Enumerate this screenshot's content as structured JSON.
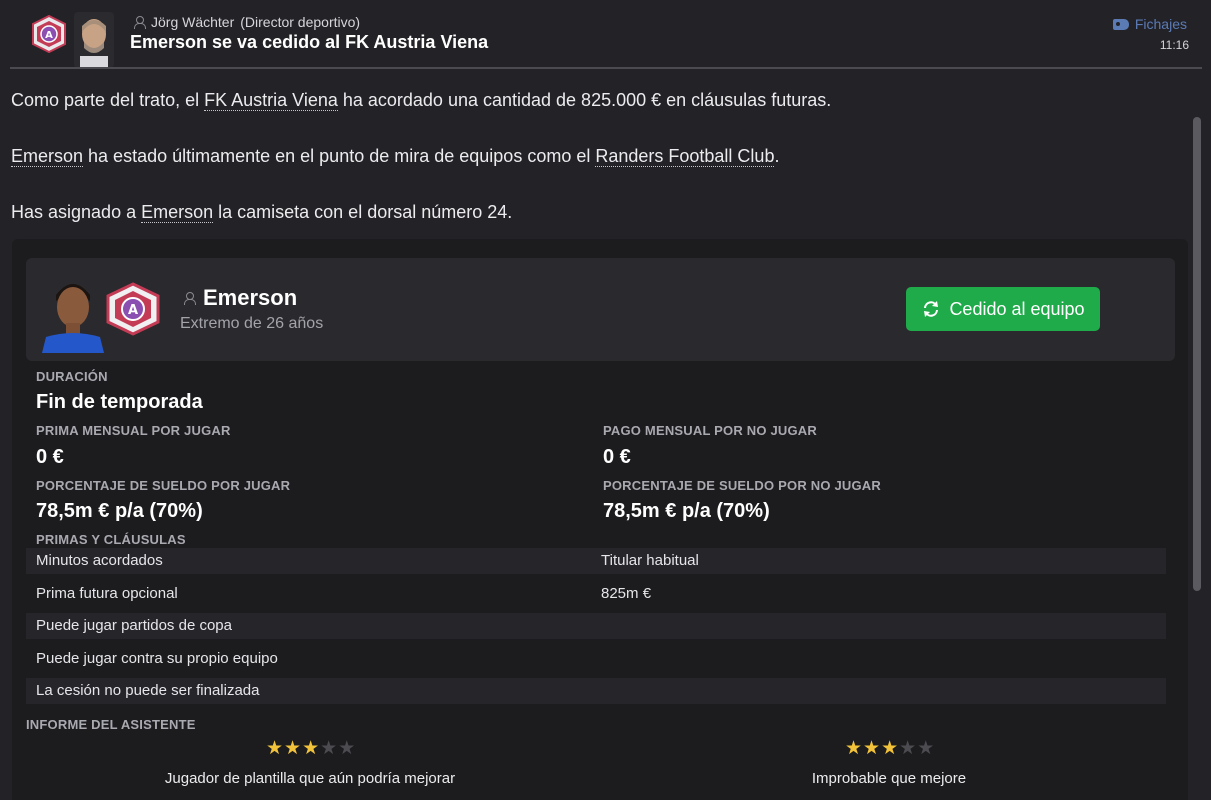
{
  "header": {
    "sender_name": "Jörg Wächter",
    "sender_role": "(Director deportivo)",
    "headline": "Emerson se va cedido al FK Austria Viena",
    "category": "Fichajes",
    "time": "11:16",
    "accent_color": "#5b7bb5"
  },
  "body": {
    "para1": {
      "pre": "Como parte del trato, el ",
      "link": "FK Austria Viena",
      "post": " ha acordado una cantidad de 825.000 € en cláusulas futuras."
    },
    "para2": {
      "link1": "Emerson",
      "mid": " ha estado últimamente en el punto de mira de equipos como el ",
      "link2": "Randers Football Club",
      "post": "."
    },
    "para3": {
      "pre": "Has asignado a ",
      "link": "Emerson",
      "post": " la camiseta con el dorsal número 24."
    }
  },
  "player": {
    "name": "Emerson",
    "description": "Extremo de 26 años",
    "status_button": "Cedido al equipo",
    "status_color": "#1fab4a"
  },
  "loan": {
    "duration_label": "DURACIÓN",
    "duration_value": "Fin de temporada",
    "monthly_fee_play_label": "PRIMA MENSUAL POR JUGAR",
    "monthly_fee_play_value": "0 €",
    "monthly_fee_noplay_label": "PAGO MENSUAL POR NO JUGAR",
    "monthly_fee_noplay_value": "0 €",
    "wage_play_label": "PORCENTAJE DE SUELDO POR JUGAR",
    "wage_play_value": "78,5m € p/a (70%)",
    "wage_noplay_label": "PORCENTAJE DE SUELDO POR NO JUGAR",
    "wage_noplay_value": "78,5m € p/a (70%)",
    "clauses_label": "PRIMAS Y CLÁUSULAS",
    "clauses": [
      {
        "name": "Minutos acordados",
        "value": "Titular habitual"
      },
      {
        "name": "Prima futura opcional",
        "value": "825m €"
      },
      {
        "name": "Puede jugar partidos de copa",
        "value": ""
      },
      {
        "name": "Puede jugar contra su propio equipo",
        "value": ""
      },
      {
        "name": "La cesión no puede ser finalizada",
        "value": ""
      }
    ]
  },
  "report": {
    "label": "INFORME DEL ASISTENTE",
    "items": [
      {
        "stars": 3,
        "max": 5,
        "text": "Jugador de plantilla que aún podría mejorar"
      },
      {
        "stars": 3,
        "max": 5,
        "text": "Improbable que mejore"
      }
    ],
    "star_color": "#f2c33a"
  }
}
